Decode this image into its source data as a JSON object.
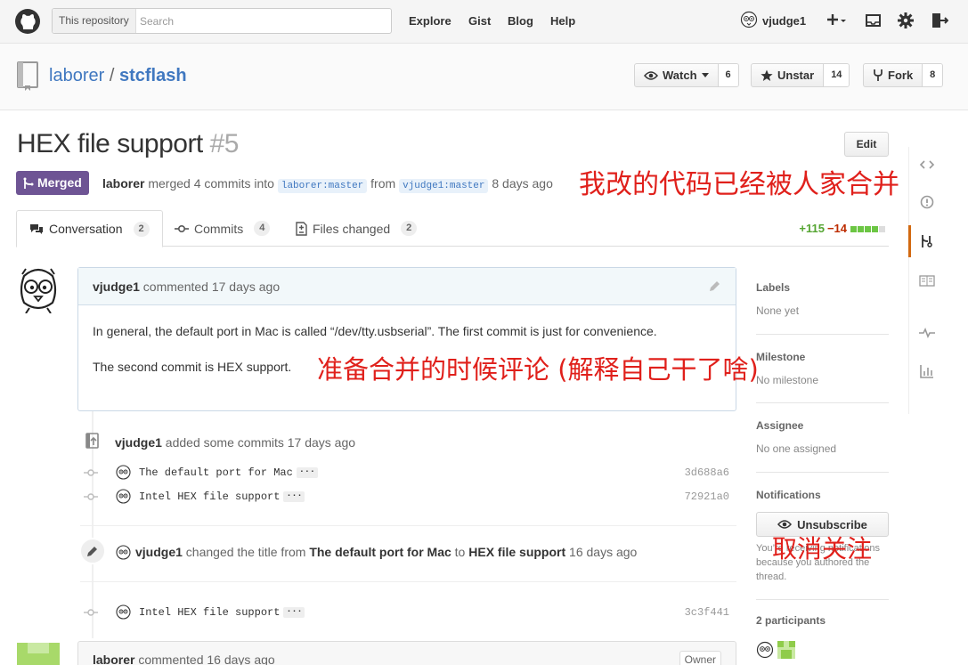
{
  "header": {
    "search_scope": "This repository",
    "search_placeholder": "Search",
    "nav": [
      "Explore",
      "Gist",
      "Blog",
      "Help"
    ],
    "username": "vjudge1"
  },
  "repo": {
    "owner": "laborer",
    "name": "stcflash",
    "watch_label": "Watch",
    "watch_count": "6",
    "unstar_label": "Unstar",
    "star_count": "14",
    "fork_label": "Fork",
    "fork_count": "8"
  },
  "pr": {
    "title": "HEX file support",
    "number": "#5",
    "edit_label": "Edit",
    "state": "Merged",
    "merger": "laborer",
    "merge_text": "merged 4 commits into",
    "base_branch": "laborer:master",
    "from_text": "from",
    "head_branch": "vjudge1:master",
    "when": "8 days ago"
  },
  "tabs": [
    {
      "label": "Conversation",
      "count": "2"
    },
    {
      "label": "Commits",
      "count": "4"
    },
    {
      "label": "Files changed",
      "count": "2"
    }
  ],
  "diffstat": {
    "additions": "+115",
    "deletions": "−14",
    "blocks_added": 4,
    "blocks_total": 5
  },
  "comment": {
    "author": "vjudge1",
    "action": "commented 17 days ago",
    "para1": "In general, the default port in Mac is called “/dev/tty.usbserial”. The first commit is just for convenience.",
    "para2": "The second commit is HEX support."
  },
  "commits_event": {
    "author": "vjudge1",
    "text": "added some commits 17 days ago"
  },
  "commits": [
    {
      "message": "The default port for Mac",
      "sha": "3d688a6"
    },
    {
      "message": "Intel HEX file support",
      "sha": "72921a0"
    }
  ],
  "rename_event": {
    "author": "vjudge1",
    "text1": "changed the title from",
    "old_title": "The default port for Mac",
    "text2": "to",
    "new_title": "HEX file support",
    "when": "16 days ago"
  },
  "commit_late": {
    "message": "Intel HEX file support",
    "sha": "3c3f441"
  },
  "comment2": {
    "author": "laborer",
    "action": "commented 16 days ago",
    "tag": "Owner"
  },
  "sidebar": {
    "labels_title": "Labels",
    "labels_value": "None yet",
    "milestone_title": "Milestone",
    "milestone_value": "No milestone",
    "assignee_title": "Assignee",
    "assignee_value": "No one assigned",
    "notifications_title": "Notifications",
    "unsubscribe_label": "Unsubscribe",
    "notifications_note": "You’re receiving notifications because you authored the thread.",
    "participants_title": "2 participants"
  },
  "annotations": {
    "merged_note": "我改的代码已经被人家合并",
    "comment_note": "准备合并的时候评论 (解释自己干了啥)",
    "unsubscribe_note": "取消关注"
  },
  "colors": {
    "merged": "#6e5494",
    "link": "#4078c0",
    "annotation": "#e0201b",
    "additions": "#55a532",
    "deletions": "#bd2c00"
  }
}
